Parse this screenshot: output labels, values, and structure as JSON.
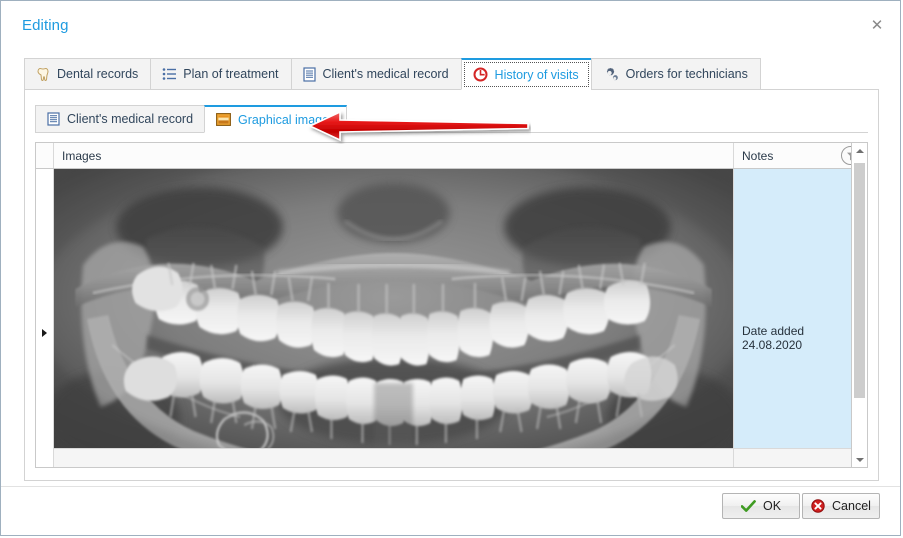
{
  "window": {
    "title": "Editing",
    "close_label": "✕",
    "title_color": "#1e9be0"
  },
  "tabs": [
    {
      "label": "Dental records",
      "icon": "tooth-icon",
      "active": false
    },
    {
      "label": "Plan of treatment",
      "icon": "bullet-list-icon",
      "active": false
    },
    {
      "label": "Client's medical record",
      "icon": "document-icon",
      "active": false
    },
    {
      "label": "History of visits",
      "icon": "clock-icon",
      "active": true
    },
    {
      "label": "Orders for technicians",
      "icon": "gears-icon",
      "active": false
    }
  ],
  "subtabs": [
    {
      "label": "Client's medical record",
      "icon": "document-icon",
      "active": false
    },
    {
      "label": "Graphical images",
      "icon": "picture-icon",
      "active": true
    }
  ],
  "grid": {
    "columns": [
      {
        "key": "images",
        "label": "Images"
      },
      {
        "key": "notes",
        "label": "Notes",
        "filter_icon": "filter-icon"
      }
    ],
    "rows": [
      {
        "images": "panoramic-dental-xray",
        "notes_line1": "Date added",
        "notes_line2": "24.08.2020",
        "selected": true
      }
    ],
    "selected_row_color": "#d5ecfa"
  },
  "annotation": {
    "type": "arrow",
    "direction": "left",
    "color": "#e01a1a",
    "points_at": "Graphical images"
  },
  "scrollbar": {
    "up_arrow": "chevron-up-icon",
    "down_arrow": "chevron-down-icon",
    "orientation": "vertical"
  },
  "footer": {
    "ok_label": "OK",
    "ok_icon": "green-check-icon",
    "cancel_label": "Cancel",
    "cancel_icon": "red-x-icon"
  }
}
